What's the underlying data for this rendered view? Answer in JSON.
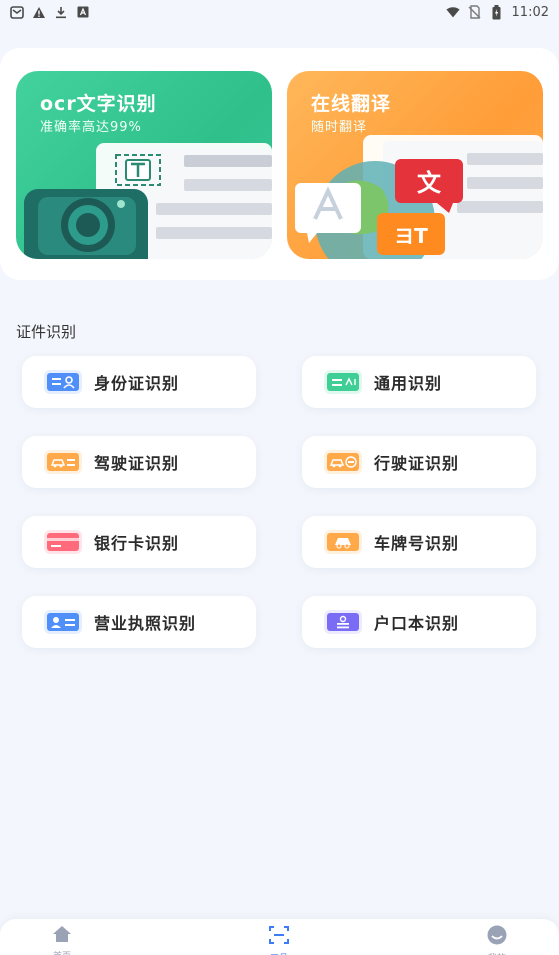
{
  "status_bar": {
    "time": "11:02",
    "left_icons": [
      "mail-icon",
      "warning-icon",
      "download-icon",
      "font-icon"
    ],
    "right_icons": [
      "wifi-icon",
      "no-sim-icon",
      "battery-icon"
    ]
  },
  "banners": [
    {
      "title": "ocr文字识别",
      "subtitle": "准确率高达99%",
      "accent": "#36c69a"
    },
    {
      "title": "在线翻译",
      "subtitle": "随时翻译",
      "accent": "#ffa243"
    }
  ],
  "section": {
    "title": "证件识别",
    "items": [
      {
        "label": "身份证识别",
        "icon": "id-card-icon",
        "color": "#4f8ff7"
      },
      {
        "label": "通用识别",
        "icon": "general-doc-icon",
        "color": "#3fcf96"
      },
      {
        "label": "驾驶证识别",
        "icon": "driver-license-icon",
        "color": "#ffa94a"
      },
      {
        "label": "行驶证识别",
        "icon": "vehicle-license-icon",
        "color": "#ffa94a"
      },
      {
        "label": "银行卡识别",
        "icon": "bank-card-icon",
        "color": "#ff6b7a"
      },
      {
        "label": "车牌号识别",
        "icon": "plate-number-icon",
        "color": "#ffa94a"
      },
      {
        "label": "营业执照识别",
        "icon": "business-license-icon",
        "color": "#4f8ff7"
      },
      {
        "label": "户口本识别",
        "icon": "household-register-icon",
        "color": "#7a6cf4"
      }
    ]
  },
  "nav": [
    {
      "label": "首页",
      "icon": "home-icon",
      "active": false
    },
    {
      "label": "工具",
      "icon": "scan-icon",
      "active": true
    },
    {
      "label": "我的",
      "icon": "profile-icon",
      "active": false
    }
  ],
  "colors": {
    "active": "#3d7bf7",
    "inactive": "#9aa3b5",
    "background": "#f3f6fc"
  }
}
